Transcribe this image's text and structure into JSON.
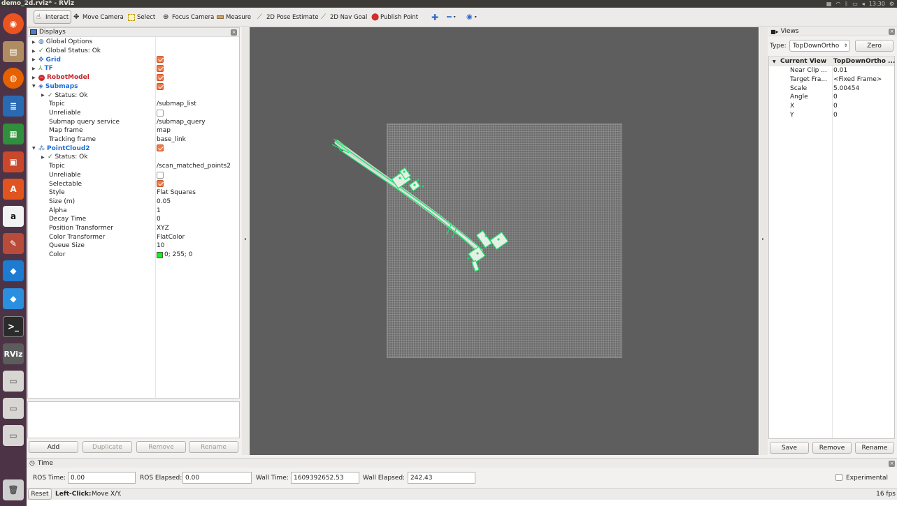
{
  "window": {
    "title": "demo_2d.rviz* - RViz",
    "clock": "13:30"
  },
  "toolbar": {
    "interact": "Interact",
    "move_camera": "Move Camera",
    "select": "Select",
    "focus_camera": "Focus Camera",
    "measure": "Measure",
    "pose_estimate": "2D Pose Estimate",
    "nav_goal": "2D Nav Goal",
    "publish_point": "Publish Point"
  },
  "displays": {
    "title": "Displays",
    "rows": {
      "global_options": "Global Options",
      "global_status": "Global Status: Ok",
      "grid": "Grid",
      "tf": "TF",
      "robot_model": "RobotModel",
      "submaps": "Submaps",
      "submaps_status": "Status: Ok",
      "submaps_topic": {
        "name": "Topic",
        "value": "/submap_list"
      },
      "submaps_unreliable": {
        "name": "Unreliable"
      },
      "submap_query": {
        "name": "Submap query service",
        "value": "/submap_query"
      },
      "map_frame": {
        "name": "Map frame",
        "value": "map"
      },
      "tracking_frame": {
        "name": "Tracking frame",
        "value": "base_link"
      },
      "pointcloud2": "PointCloud2",
      "pc_status": "Status: Ok",
      "pc_topic": {
        "name": "Topic",
        "value": "/scan_matched_points2"
      },
      "pc_unreliable": {
        "name": "Unreliable"
      },
      "pc_selectable": {
        "name": "Selectable"
      },
      "pc_style": {
        "name": "Style",
        "value": "Flat Squares"
      },
      "pc_size": {
        "name": "Size (m)",
        "value": "0.05"
      },
      "pc_alpha": {
        "name": "Alpha",
        "value": "1"
      },
      "pc_decay": {
        "name": "Decay Time",
        "value": "0"
      },
      "pc_position": {
        "name": "Position Transformer",
        "value": "XYZ"
      },
      "pc_color_tf": {
        "name": "Color Transformer",
        "value": "FlatColor"
      },
      "pc_queue": {
        "name": "Queue Size",
        "value": "10"
      },
      "pc_color": {
        "name": "Color",
        "value": "0; 255; 0",
        "swatch": "#00ff00"
      }
    },
    "buttons": {
      "add": "Add",
      "duplicate": "Duplicate",
      "remove": "Remove",
      "rename": "Rename"
    }
  },
  "views": {
    "title": "Views",
    "type_label": "Type:",
    "type_value": "TopDownOrtho",
    "zero": "Zero",
    "current_view": {
      "name": "Current View",
      "value": "TopDownOrtho ..."
    },
    "props": [
      {
        "name": "Near Clip ...",
        "value": "0.01"
      },
      {
        "name": "Target Fra...",
        "value": "<Fixed Frame>"
      },
      {
        "name": "Scale",
        "value": "5.00454"
      },
      {
        "name": "Angle",
        "value": "0"
      },
      {
        "name": "X",
        "value": "0"
      },
      {
        "name": "Y",
        "value": "0"
      }
    ],
    "buttons": {
      "save": "Save",
      "remove": "Remove",
      "rename": "Rename"
    }
  },
  "time": {
    "title": "Time",
    "ros_time_label": "ROS Time:",
    "ros_time": "0.00",
    "ros_elapsed_label": "ROS Elapsed:",
    "ros_elapsed": "0.00",
    "wall_time_label": "Wall Time:",
    "wall_time": "1609392652.53",
    "wall_elapsed_label": "Wall Elapsed:",
    "wall_elapsed": "242.43",
    "experimental": "Experimental"
  },
  "status": {
    "reset": "Reset",
    "hint_bold": "Left-Click:",
    "hint": "Move X/Y.",
    "fps": "16 fps"
  },
  "launcher": {
    "rviz": "RViz"
  },
  "colors": {
    "accent": "#1c6ed7",
    "robot_red": "#c0262d",
    "checkbox": "#f07746",
    "points": "#19e36a"
  }
}
